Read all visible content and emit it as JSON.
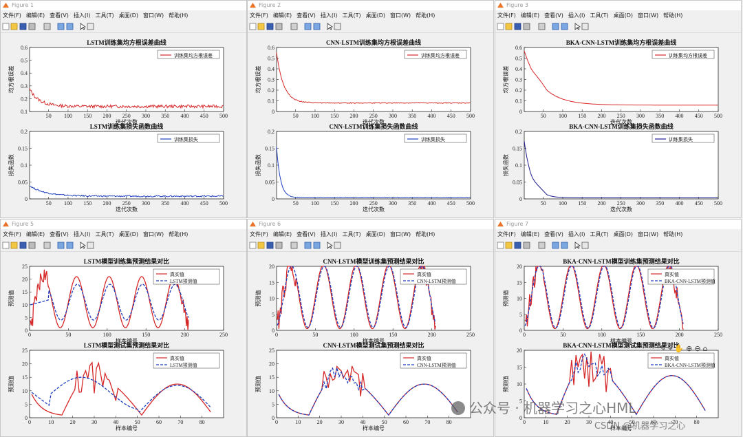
{
  "menu": [
    "文件(F)",
    "编辑(E)",
    "查看(V)",
    "插入(I)",
    "工具(T)",
    "桌面(D)",
    "窗口(W)",
    "帮助(H)"
  ],
  "watermark": "公众号 · 机器学习之心HML",
  "csdn": "CSDN @机器学习之心",
  "colors": {
    "red": "#d62728",
    "blue": "#1f3fbf",
    "navy": "#1a1a8c"
  },
  "windows": [
    {
      "title": "Figure 1",
      "charts": [
        {
          "type": "line",
          "title": "LSTM训练集均方根误差曲线",
          "xlabel": "迭代次数",
          "ylabel": "均方根误差",
          "xlim": [
            1,
            500
          ],
          "ylim": [
            0.1,
            0.6
          ],
          "xticks": [
            50,
            100,
            150,
            200,
            250,
            300,
            350,
            400,
            450,
            500
          ],
          "yticks": [
            0.1,
            0.2,
            0.3,
            0.4,
            0.5,
            0.6
          ],
          "legend": [
            "训练集均方根误差"
          ],
          "color": "#d62728",
          "curve": "noisy",
          "start": 0.28,
          "end": 0.14,
          "tau": 25,
          "noise": 0.012
        },
        {
          "type": "line",
          "title": "LSTM训练集损失函数曲线",
          "xlabel": "迭代次数",
          "ylabel": "损失函数",
          "xlim": [
            1,
            500
          ],
          "ylim": [
            0,
            0.2
          ],
          "xticks": [
            50,
            100,
            150,
            200,
            250,
            300,
            350,
            400,
            450,
            500
          ],
          "yticks": [
            0,
            0.05,
            0.1,
            0.15,
            0.2
          ],
          "legend": [
            "训练集损失"
          ],
          "color": "#1f3fbf",
          "curve": "noisy",
          "start": 0.04,
          "end": 0.008,
          "tau": 40,
          "noise": 0.002
        }
      ]
    },
    {
      "title": "Figure 2",
      "charts": [
        {
          "type": "line",
          "title": "CNN-LSTM训练集均方根误差曲线",
          "xlabel": "迭代次数",
          "ylabel": "均方根误差",
          "xlim": [
            1,
            500
          ],
          "ylim": [
            0,
            0.6
          ],
          "xticks": [
            50,
            100,
            150,
            200,
            250,
            300,
            350,
            400,
            450,
            500
          ],
          "yticks": [
            0,
            0.1,
            0.2,
            0.3,
            0.4,
            0.5,
            0.6
          ],
          "legend": [
            "训练集均方根误差"
          ],
          "color": "#d62728",
          "curve": "noisy",
          "start": 0.58,
          "end": 0.08,
          "tau": 18,
          "noise": 0.004
        },
        {
          "type": "line",
          "title": "CNN-LSTM训练集损失函数曲线",
          "xlabel": "迭代次数",
          "ylabel": "损失函数",
          "xlim": [
            1,
            500
          ],
          "ylim": [
            0,
            0.2
          ],
          "xticks": [
            50,
            100,
            150,
            200,
            250,
            300,
            350,
            400,
            450,
            500
          ],
          "yticks": [
            0,
            0.05,
            0.1,
            0.15,
            0.2
          ],
          "legend": [
            "训练集损失"
          ],
          "color": "#1f3fbf",
          "curve": "noisy",
          "start": 0.17,
          "end": 0.004,
          "tau": 10,
          "noise": 0.001
        }
      ]
    },
    {
      "title": "Figure 3",
      "charts": [
        {
          "type": "line",
          "title": "BKA-CNN-LSTM训练集均方根误差曲线",
          "xlabel": "迭代次数",
          "ylabel": "均方根误差",
          "xlim": [
            1,
            500
          ],
          "ylim": [
            0,
            0.6
          ],
          "xticks": [
            50,
            100,
            150,
            200,
            250,
            300,
            350,
            400,
            450,
            500
          ],
          "yticks": [
            0,
            0.1,
            0.2,
            0.3,
            0.4,
            0.5,
            0.6
          ],
          "legend": [
            "训练集均方根误差"
          ],
          "color": "#d62728",
          "curve": "smooth",
          "start": 0.58,
          "end": 0.06,
          "tau": 45,
          "noise": 0.0
        },
        {
          "type": "line",
          "title": "BKA-CNN-LSTM训练集损失函数曲线",
          "xlabel": "迭代次数",
          "ylabel": "损失函数",
          "xlim": [
            1,
            500
          ],
          "ylim": [
            0,
            0.2
          ],
          "xticks": [
            50,
            100,
            150,
            200,
            250,
            300,
            350,
            400,
            450,
            500
          ],
          "yticks": [
            0,
            0.05,
            0.1,
            0.15,
            0.2
          ],
          "legend": [
            "训练集损失"
          ],
          "color": "#1a1a8c",
          "curve": "smooth",
          "start": 0.18,
          "end": 0.003,
          "tau": 20,
          "noise": 0.0
        }
      ]
    },
    {
      "title": "Figure 5",
      "charts": [
        {
          "type": "line",
          "title": "LSTM模型训练集预测结果对比",
          "xlabel": "样本编号",
          "ylabel": "预测值",
          "xlim": [
            0,
            250
          ],
          "ylim": [
            0,
            25
          ],
          "xticks": [
            0,
            50,
            100,
            150,
            200,
            250
          ],
          "yticks": [
            0,
            5,
            10,
            15,
            20,
            25
          ],
          "legend": [
            "真实值",
            "LSTM预测值"
          ],
          "curve": "sine",
          "n": 205,
          "period": 42,
          "amp_true": 10,
          "amp_pred": 7,
          "center": 11
        },
        {
          "type": "line",
          "title": "LSTM模型测试集预测结果对比",
          "xlabel": "样本编号",
          "ylabel": "预测值",
          "xlim": [
            0,
            90
          ],
          "ylim": [
            0,
            25
          ],
          "xticks": [
            0,
            10,
            20,
            30,
            40,
            50,
            60,
            70,
            80
          ],
          "yticks": [
            0,
            5,
            10,
            15,
            20,
            25
          ],
          "legend": [
            "真实值",
            "LSTM预测值"
          ],
          "curve": "test",
          "n": 84,
          "smooth_pred": true
        }
      ]
    },
    {
      "title": "Figure 6",
      "charts": [
        {
          "type": "line",
          "title": "CNN-LSTM模型训练集预测结果对比",
          "xlabel": "样本编号",
          "ylabel": "预测值",
          "xlim": [
            0,
            250
          ],
          "ylim": [
            0,
            20
          ],
          "xticks": [
            0,
            50,
            100,
            150,
            200,
            250
          ],
          "yticks": [
            0,
            5,
            10,
            15,
            20
          ],
          "legend": [
            "真实值",
            "CNN-LSTM预测值"
          ],
          "curve": "sine",
          "n": 205,
          "period": 42,
          "amp_true": 10,
          "amp_pred": 9.6,
          "center": 10.5
        },
        {
          "type": "line",
          "title": "CNN-LSTM模型测试集预测结果对比",
          "xlabel": "样本编号",
          "ylabel": "预测值",
          "xlim": [
            0,
            90
          ],
          "ylim": [
            0,
            25
          ],
          "xticks": [
            0,
            10,
            20,
            30,
            40,
            50,
            60,
            70,
            80
          ],
          "yticks": [
            0,
            5,
            10,
            15,
            20,
            25
          ],
          "legend": [
            "真实值",
            "CNN-LSTM预测值"
          ],
          "curve": "test",
          "n": 84,
          "smooth_pred": false
        }
      ]
    },
    {
      "title": "Figure 7",
      "charts": [
        {
          "type": "line",
          "title": "BKA-CNN-LSTM模型训练集预测结果对比",
          "xlabel": "样本编号",
          "ylabel": "预测值",
          "xlim": [
            0,
            250
          ],
          "ylim": [
            0,
            20
          ],
          "xticks": [
            0,
            50,
            100,
            150,
            200,
            250
          ],
          "yticks": [
            0,
            5,
            10,
            15,
            20
          ],
          "legend": [
            "真实值",
            "BKA-CNN-LSTM预测值"
          ],
          "curve": "sine",
          "n": 205,
          "period": 42,
          "amp_true": 10,
          "amp_pred": 9.8,
          "center": 10.5
        },
        {
          "type": "line",
          "title": "BKA-CNN-LSTM模型测试集预测结果对比",
          "xlabel": "样本编号",
          "ylabel": "预测值",
          "xlim": [
            0,
            90
          ],
          "ylim": [
            0,
            20
          ],
          "xticks": [
            0,
            10,
            20,
            30,
            40,
            50,
            60,
            70,
            80
          ],
          "yticks": [
            0,
            5,
            10,
            15,
            20
          ],
          "legend": [
            "真实值",
            "BKA-CNN-LSTM预测值"
          ],
          "curve": "test",
          "n": 84,
          "smooth_pred": false
        }
      ]
    }
  ]
}
